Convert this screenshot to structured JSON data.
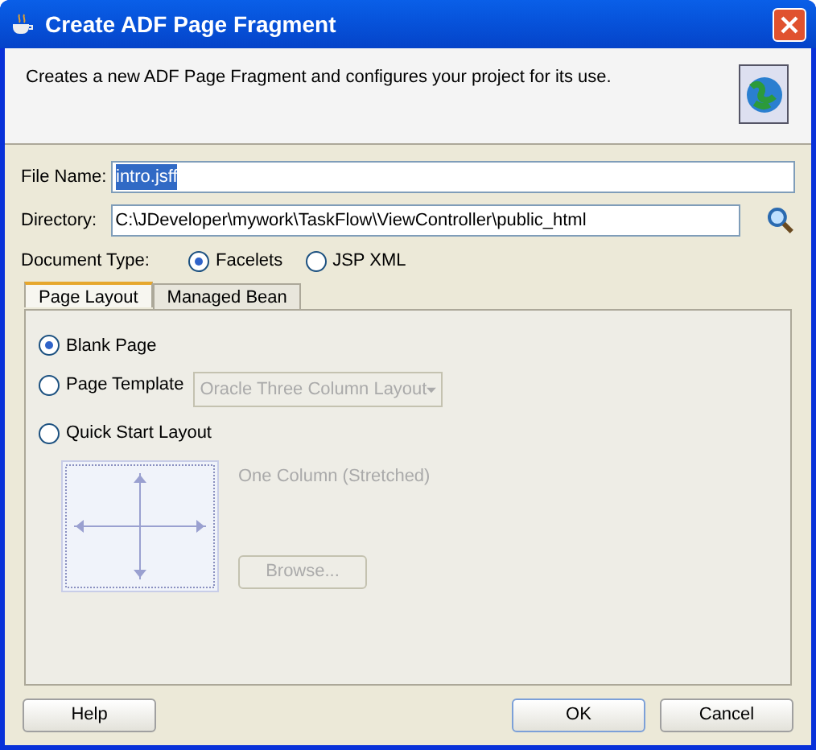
{
  "window": {
    "title": "Create ADF Page Fragment"
  },
  "header": {
    "description": "Creates a new ADF Page Fragment and configures your project for its use."
  },
  "file_name": {
    "label": "File Name:",
    "value": "intro.jsff"
  },
  "directory": {
    "label": "Directory:",
    "value": "C:\\JDeveloper\\mywork\\TaskFlow\\ViewController\\public_html"
  },
  "document_type": {
    "label": "Document Type:",
    "options": [
      {
        "label": "Facelets",
        "selected": true
      },
      {
        "label": "JSP XML",
        "selected": false
      }
    ]
  },
  "tabs": [
    {
      "label": "Page Layout",
      "selected": true
    },
    {
      "label": "Managed Bean",
      "selected": false
    }
  ],
  "layout_options": [
    {
      "label": "Blank Page",
      "selected": true
    },
    {
      "label": "Page Template",
      "selected": false
    },
    {
      "label": "Quick Start Layout",
      "selected": false
    }
  ],
  "template_select": {
    "value": "Oracle Three Column Layout",
    "disabled": true
  },
  "quick_start": {
    "layout_name": "One Column (Stretched)",
    "browse": "Browse...",
    "disabled": true
  },
  "buttons": [
    {
      "label": "Help",
      "default": false
    },
    {
      "label": "OK",
      "default": true
    },
    {
      "label": "Cancel",
      "default": false
    }
  ]
}
